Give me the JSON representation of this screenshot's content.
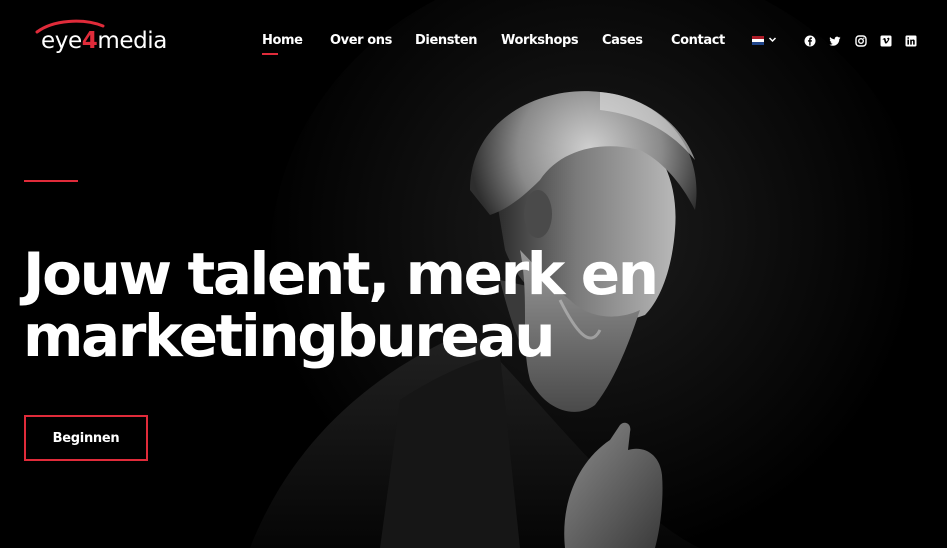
{
  "logo": {
    "prefix": "eye",
    "number": "4",
    "suffix": "media"
  },
  "nav": {
    "items": [
      {
        "label": "Home",
        "active": true
      },
      {
        "label": "Over ons",
        "active": false
      },
      {
        "label": "Diensten",
        "active": false
      },
      {
        "label": "Workshops",
        "active": false
      },
      {
        "label": "Cases",
        "active": false
      },
      {
        "label": "Contact",
        "active": false
      }
    ],
    "language": {
      "flag": "dutch-flag-icon",
      "colors": [
        "#ae1c28",
        "#ffffff",
        "#21468b"
      ]
    }
  },
  "social": [
    "facebook-icon",
    "twitter-icon",
    "instagram-icon",
    "vimeo-icon",
    "linkedin-icon"
  ],
  "hero": {
    "headline_line1": "Jouw talent, merk en",
    "headline_line2": "marketingbureau",
    "cta_label": "Beginnen",
    "photo": "bearded-man-portrait"
  },
  "colors": {
    "accent": "#e02b3a",
    "background": "#000000",
    "text": "#ffffff"
  }
}
